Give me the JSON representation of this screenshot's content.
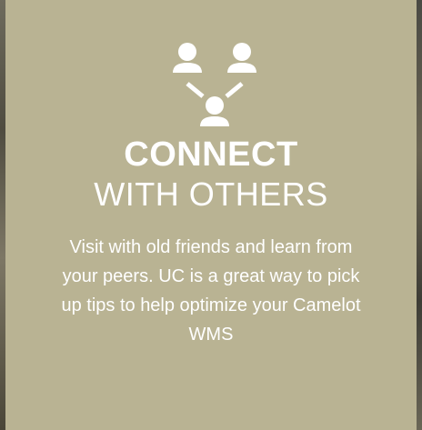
{
  "card": {
    "icon": "connect-people-icon",
    "title_strong": "CONNECT",
    "title_light": "WITH OTHERS",
    "body": "Visit with old friends and learn from your peers. UC is a great way to pick up tips to help optimize your Camelot WMS",
    "colors": {
      "panel": "#b9b393",
      "text": "#ffffff"
    }
  }
}
